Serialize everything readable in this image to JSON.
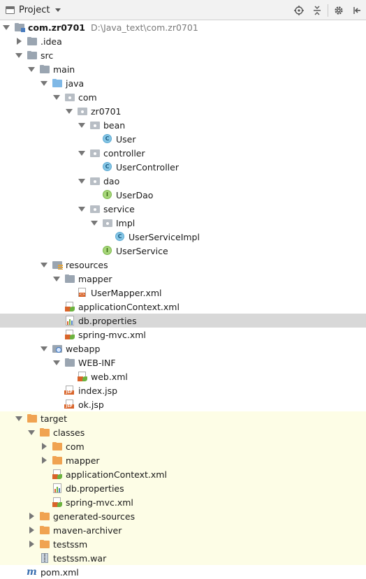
{
  "toolbar": {
    "title": "Project",
    "icons": [
      "locate-icon",
      "collapse-icon",
      "gear-icon",
      "hide-icon"
    ]
  },
  "tree": [
    {
      "label": "com.zr0701",
      "path": "D:\\Java_text\\com.zr0701",
      "type": "module",
      "arrow": "down",
      "depth": 0,
      "bold": true
    },
    {
      "label": ".idea",
      "type": "folder",
      "arrow": "right",
      "depth": 1
    },
    {
      "label": "src",
      "type": "folder",
      "arrow": "down",
      "depth": 1
    },
    {
      "label": "main",
      "type": "folder",
      "arrow": "down",
      "depth": 2
    },
    {
      "label": "java",
      "type": "folder-blue",
      "arrow": "down",
      "depth": 3
    },
    {
      "label": "com",
      "type": "package",
      "arrow": "down",
      "depth": 4
    },
    {
      "label": "zr0701",
      "type": "package",
      "arrow": "down",
      "depth": 5
    },
    {
      "label": "bean",
      "type": "package",
      "arrow": "down",
      "depth": 6
    },
    {
      "label": "User",
      "type": "class",
      "arrow": "none",
      "depth": 7
    },
    {
      "label": "controller",
      "type": "package",
      "arrow": "down",
      "depth": 6
    },
    {
      "label": "UserController",
      "type": "class",
      "arrow": "none",
      "depth": 7
    },
    {
      "label": "dao",
      "type": "package",
      "arrow": "down",
      "depth": 6
    },
    {
      "label": "UserDao",
      "type": "interface",
      "arrow": "none",
      "depth": 7
    },
    {
      "label": "service",
      "type": "package",
      "arrow": "down",
      "depth": 6
    },
    {
      "label": "Impl",
      "type": "package",
      "arrow": "down",
      "depth": 7
    },
    {
      "label": "UserServiceImpl",
      "type": "class",
      "arrow": "none",
      "depth": 8
    },
    {
      "label": "UserService",
      "type": "interface",
      "arrow": "none",
      "depth": 7
    },
    {
      "label": "resources",
      "type": "resources",
      "arrow": "down",
      "depth": 3
    },
    {
      "label": "mapper",
      "type": "folder",
      "arrow": "down",
      "depth": 4
    },
    {
      "label": "UserMapper.xml",
      "type": "xml",
      "arrow": "none",
      "depth": 5
    },
    {
      "label": "applicationContext.xml",
      "type": "spring",
      "arrow": "none",
      "depth": 4
    },
    {
      "label": "db.properties",
      "type": "properties",
      "arrow": "none",
      "depth": 4,
      "selected": true
    },
    {
      "label": "spring-mvc.xml",
      "type": "spring",
      "arrow": "none",
      "depth": 4
    },
    {
      "label": "webapp",
      "type": "web",
      "arrow": "down",
      "depth": 3
    },
    {
      "label": "WEB-INF",
      "type": "folder",
      "arrow": "down",
      "depth": 4
    },
    {
      "label": "web.xml",
      "type": "spring",
      "arrow": "none",
      "depth": 5
    },
    {
      "label": "index.jsp",
      "type": "jsp",
      "arrow": "none",
      "depth": 4
    },
    {
      "label": "ok.jsp",
      "type": "jsp",
      "arrow": "none",
      "depth": 4
    },
    {
      "label": "target",
      "type": "folder-orange",
      "arrow": "down",
      "depth": 1,
      "excluded": true
    },
    {
      "label": "classes",
      "type": "folder-orange",
      "arrow": "down",
      "depth": 2,
      "excluded": true
    },
    {
      "label": "com",
      "type": "folder-orange",
      "arrow": "right",
      "depth": 3,
      "excluded": true
    },
    {
      "label": "mapper",
      "type": "folder-orange",
      "arrow": "right",
      "depth": 3,
      "excluded": true
    },
    {
      "label": "applicationContext.xml",
      "type": "spring",
      "arrow": "none",
      "depth": 3,
      "excluded": true
    },
    {
      "label": "db.properties",
      "type": "properties",
      "arrow": "none",
      "depth": 3,
      "excluded": true
    },
    {
      "label": "spring-mvc.xml",
      "type": "spring",
      "arrow": "none",
      "depth": 3,
      "excluded": true
    },
    {
      "label": "generated-sources",
      "type": "folder-orange",
      "arrow": "right",
      "depth": 2,
      "excluded": true
    },
    {
      "label": "maven-archiver",
      "type": "folder-orange",
      "arrow": "right",
      "depth": 2,
      "excluded": true
    },
    {
      "label": "testssm",
      "type": "folder-orange",
      "arrow": "right",
      "depth": 2,
      "excluded": true
    },
    {
      "label": "testssm.war",
      "type": "war",
      "arrow": "none",
      "depth": 2,
      "excluded": true
    },
    {
      "label": "pom.xml",
      "type": "maven",
      "arrow": "none",
      "depth": 1
    }
  ]
}
